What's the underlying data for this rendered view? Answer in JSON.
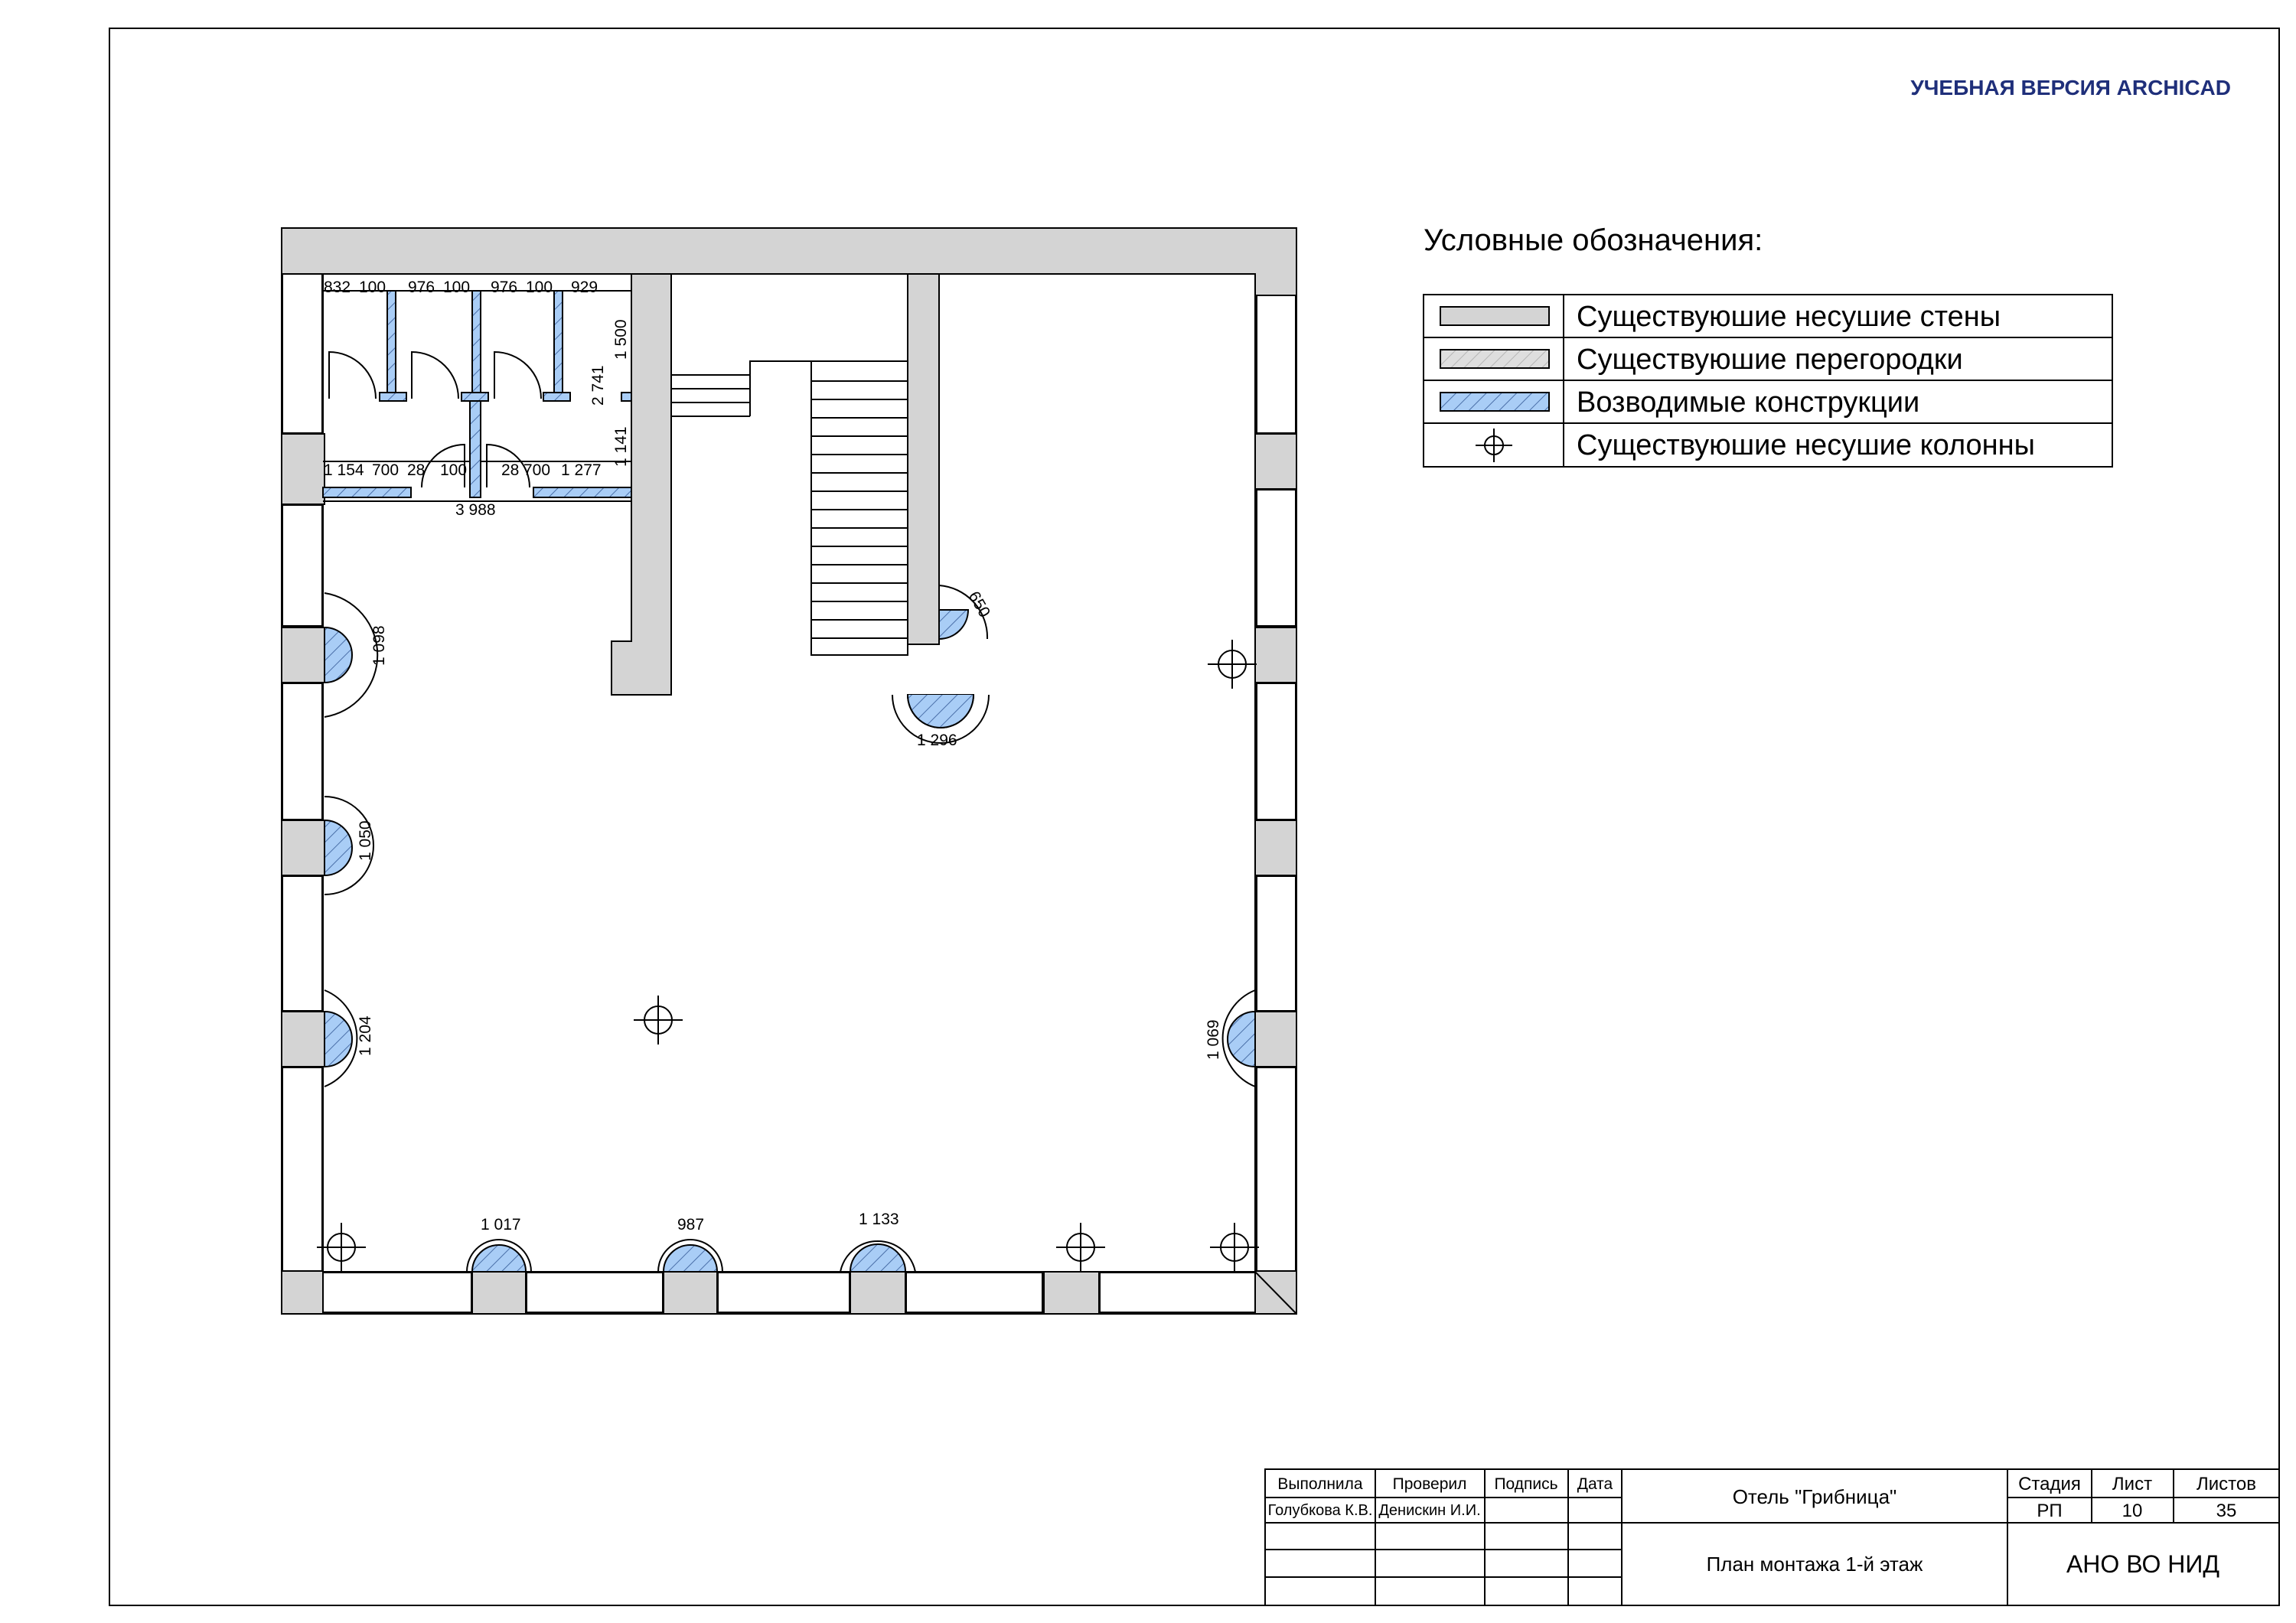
{
  "watermark": "УЧЕБНАЯ ВЕРСИЯ ARCHICAD",
  "legend": {
    "title": "Условные обозначения:",
    "items": [
      {
        "label": "Существуюшие несушие стены",
        "swatch": "wall"
      },
      {
        "label": "Существуюшие перегородки",
        "swatch": "partition"
      },
      {
        "label": "Возводимые конструкции",
        "swatch": "new"
      },
      {
        "label": "Существуюшие несушие колонны",
        "swatch": "column-symbol"
      }
    ]
  },
  "colors": {
    "wall": "#d4d4d4",
    "partition": "#dedede",
    "new": "#a9cdf6",
    "line": "#000000",
    "watermark": "#1f2f7a"
  },
  "plan": {
    "dims": {
      "top_row": [
        "832",
        "100",
        "976",
        "100",
        "976",
        "100",
        "929"
      ],
      "right_col": [
        "1 500",
        "2 741",
        "1 141"
      ],
      "bottom_row": [
        "1 154",
        "700",
        "28",
        "100",
        "28",
        "700",
        "1 277"
      ],
      "total": "3 988",
      "arcs": {
        "left1": "1 098",
        "left2": "1 050",
        "left3": "1 204",
        "right1": "1 069",
        "bottom1": "1 017",
        "bottom2": "987",
        "bottom3": "1 133",
        "stair_top": "650",
        "stair_bottom": "1 296"
      }
    }
  },
  "stamp": {
    "headers": {
      "performed": "Выполнила",
      "checked": "Проверил",
      "signature": "Подпись",
      "date": "Дата"
    },
    "performer": "Голубкова К.В.",
    "checker": "Денискин И.И.",
    "project": "Отель \"Грибница\"",
    "sheet_title": "План монтажа 1-й этаж",
    "stage_label": "Стадия",
    "sheet_label": "Лист",
    "sheets_label": "Листов",
    "stage": "РП",
    "sheet": "10",
    "sheets": "35",
    "organization": "АНО ВО НИД"
  }
}
